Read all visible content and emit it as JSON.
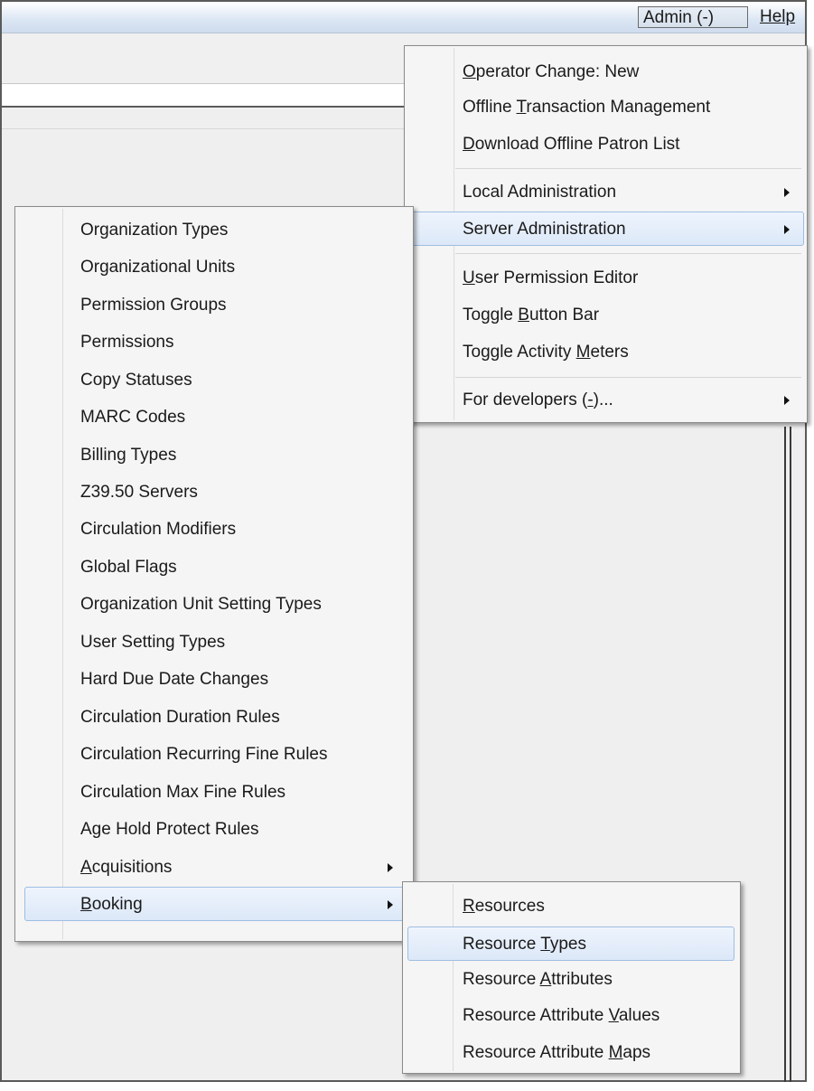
{
  "menubar": {
    "admin_label": "Admin (-)",
    "help_label": "Help"
  },
  "admin_menu": {
    "items": [
      {
        "pre": "",
        "accel": "O",
        "post": "perator Change: New"
      },
      {
        "pre": "Offline ",
        "accel": "T",
        "post": "ransaction Management"
      },
      {
        "pre": "",
        "accel": "D",
        "post": "ownload Offline Patron List"
      },
      {
        "pre": "Local Administration",
        "accel": "",
        "post": ""
      },
      {
        "pre": "Server Administration",
        "accel": "",
        "post": ""
      },
      {
        "pre": "",
        "accel": "U",
        "post": "ser Permission Editor"
      },
      {
        "pre": "Toggle ",
        "accel": "B",
        "post": "utton Bar"
      },
      {
        "pre": "Toggle Activity ",
        "accel": "M",
        "post": "eters"
      },
      {
        "pre": "For developers (",
        "accel": "-",
        "post": ")..."
      }
    ]
  },
  "server_admin_menu": {
    "items": [
      "Organization Types",
      "Organizational Units",
      "Permission Groups",
      "Permissions",
      "Copy Statuses",
      "MARC Codes",
      "Billing Types",
      "Z39.50 Servers",
      "Circulation Modifiers",
      "Global Flags",
      "Organization Unit Setting Types",
      "User Setting Types",
      "Hard Due Date Changes",
      "Circulation Duration Rules",
      "Circulation Recurring Fine Rules",
      "Circulation Max Fine Rules",
      "Age Hold Protect Rules"
    ],
    "acquisitions": {
      "pre": "",
      "accel": "A",
      "post": "cquisitions"
    },
    "booking": {
      "pre": "",
      "accel": "B",
      "post": "ooking"
    }
  },
  "booking_menu": {
    "items": [
      {
        "pre": "",
        "accel": "R",
        "post": "esources"
      },
      {
        "pre": "Resource ",
        "accel": "T",
        "post": "ypes"
      },
      {
        "pre": "Resource ",
        "accel": "A",
        "post": "ttributes"
      },
      {
        "pre": "Resource Attribute ",
        "accel": "V",
        "post": "alues"
      },
      {
        "pre": "Resource Attribute ",
        "accel": "M",
        "post": "aps"
      }
    ]
  },
  "colors": {
    "highlight_border": "#9fbde3",
    "menubar_gradient": "#dbe6f4"
  },
  "icons": [
    "submenu-arrow-icon"
  ]
}
